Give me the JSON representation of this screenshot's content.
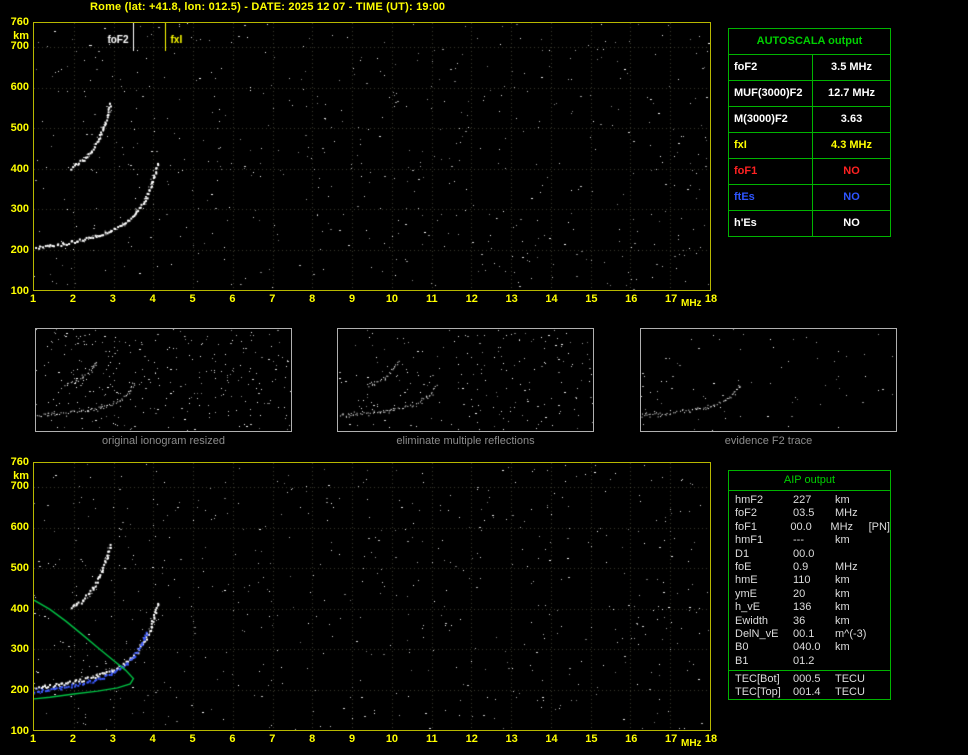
{
  "header": {
    "title": "Rome (lat: +41.8, lon: 012.5) - DATE: 2025 12 07 - TIME (UT): 19:00"
  },
  "autoscala": {
    "title": "AUTOSCALA output",
    "border_color": "#00b400",
    "rows": [
      {
        "param": "foF2",
        "value": "3.5 MHz",
        "color": "#ffffff"
      },
      {
        "param": "MUF(3000)F2",
        "value": "12.7 MHz",
        "color": "#ffffff"
      },
      {
        "param": "M(3000)F2",
        "value": "3.63",
        "color": "#ffffff"
      },
      {
        "param": "fxI",
        "value": "4.3 MHz",
        "color": "#ffff00"
      },
      {
        "param": "foF1",
        "value": "NO",
        "color": "#ff2222"
      },
      {
        "param": "ftEs",
        "value": "NO",
        "color": "#2e55ff"
      },
      {
        "param": "h'Es",
        "value": "NO",
        "color": "#ffffff"
      }
    ]
  },
  "thumbnails": {
    "panels": [
      {
        "caption": "original ionogram resized",
        "noise_density": 0.012,
        "seed": 3,
        "xlim": [
          1,
          9
        ],
        "series_names": [
          "F2-trace",
          "multiple-reflection"
        ]
      },
      {
        "caption": "eliminate multiple reflections",
        "noise_density": 0.008,
        "seed": 4,
        "xlim": [
          1,
          9
        ],
        "series_names": [
          "F2-trace",
          "multiple-reflection"
        ]
      },
      {
        "caption": "evidence F2 trace",
        "noise_density": 0.003,
        "seed": 5,
        "xlim": [
          1,
          9
        ],
        "series_names": [
          "F2-trace"
        ]
      }
    ]
  },
  "aip": {
    "title": "AIP output",
    "rows": [
      {
        "label": "hmF2",
        "value": "227",
        "unit": "km"
      },
      {
        "label": "foF2",
        "value": "03.5",
        "unit": "MHz"
      },
      {
        "label": "foF1",
        "value": "00.0",
        "unit": "MHz",
        "note": "[PN]"
      },
      {
        "label": "hmF1",
        "value": "---",
        "unit": "km"
      },
      {
        "label": "D1",
        "value": "00.0",
        "unit": ""
      },
      {
        "label": "foE",
        "value": "0.9",
        "unit": "MHz"
      },
      {
        "label": "hmE",
        "value": "110",
        "unit": "km"
      },
      {
        "label": "ymE",
        "value": "20",
        "unit": "km"
      },
      {
        "label": "h_vE",
        "value": "136",
        "unit": "km"
      },
      {
        "label": "Ewidth",
        "value": "36",
        "unit": "km"
      },
      {
        "label": "DelN_vE",
        "value": "00.1",
        "unit": "m^(-3)"
      },
      {
        "label": "B0",
        "value": "040.0",
        "unit": "km"
      },
      {
        "label": "B1",
        "value": "01.2",
        "unit": ""
      },
      {
        "label": "TEC[Bot]",
        "value": "000.5",
        "unit": "TECU",
        "divider_before": true
      },
      {
        "label": "TEC[Top]",
        "value": "001.4",
        "unit": "TECU"
      }
    ]
  },
  "chart_data": [
    {
      "id": "top_ionogram",
      "type": "scatter",
      "title": "",
      "xlabel": "MHz",
      "ylabel": "km",
      "xlim": [
        1,
        18
      ],
      "ylim": [
        100,
        760
      ],
      "x_ticks": [
        1,
        2,
        3,
        4,
        5,
        6,
        7,
        8,
        9,
        10,
        11,
        12,
        13,
        14,
        15,
        16,
        17,
        18
      ],
      "y_ticks": [
        100,
        200,
        300,
        400,
        500,
        600,
        700,
        760
      ],
      "grid": true,
      "noise_density": 0.0032,
      "seed": 7,
      "markers": [
        {
          "label": "foF2",
          "x": 3.5,
          "color": "#ffffff",
          "label_side": "left"
        },
        {
          "label": "fxI",
          "x": 4.3,
          "color": "#ffff00",
          "label_side": "right"
        }
      ],
      "series": [
        {
          "name": "F2-trace",
          "color": "#ffffff",
          "style": "dots",
          "points": [
            [
              1.05,
              205
            ],
            [
              1.4,
              210
            ],
            [
              1.8,
              217
            ],
            [
              2.2,
              225
            ],
            [
              2.6,
              236
            ],
            [
              3.0,
              251
            ],
            [
              3.3,
              268
            ],
            [
              3.55,
              291
            ],
            [
              3.75,
              319
            ],
            [
              3.9,
              350
            ],
            [
              4.0,
              382
            ],
            [
              4.12,
              418
            ]
          ]
        },
        {
          "name": "multiple-reflection",
          "color": "#ffffff",
          "style": "dots",
          "points": [
            [
              1.9,
              402
            ],
            [
              2.2,
              421
            ],
            [
              2.45,
              447
            ],
            [
              2.65,
              482
            ],
            [
              2.8,
              523
            ],
            [
              2.92,
              565
            ]
          ]
        }
      ]
    },
    {
      "id": "bottom_ionogram",
      "type": "scatter",
      "title": "",
      "xlabel": "MHz",
      "ylabel": "km",
      "xlim": [
        1,
        18
      ],
      "ylim": [
        100,
        760
      ],
      "x_ticks": [
        1,
        2,
        3,
        4,
        5,
        6,
        7,
        8,
        9,
        10,
        11,
        12,
        13,
        14,
        15,
        16,
        17,
        18
      ],
      "y_ticks": [
        100,
        200,
        300,
        400,
        500,
        600,
        700,
        760
      ],
      "grid": true,
      "noise_density": 0.0032,
      "seed": 13,
      "markers": [],
      "series": [
        {
          "name": "F2-trace",
          "color": "#ffffff",
          "style": "dots",
          "points": [
            [
              1.05,
              205
            ],
            [
              1.4,
              210
            ],
            [
              1.8,
              217
            ],
            [
              2.2,
              225
            ],
            [
              2.6,
              236
            ],
            [
              3.0,
              251
            ],
            [
              3.3,
              268
            ],
            [
              3.55,
              291
            ],
            [
              3.75,
              319
            ],
            [
              3.9,
              350
            ],
            [
              4.0,
              382
            ],
            [
              4.12,
              418
            ]
          ]
        },
        {
          "name": "multiple-reflection",
          "color": "#ffffff",
          "style": "dots",
          "points": [
            [
              1.9,
              402
            ],
            [
              2.2,
              421
            ],
            [
              2.45,
              447
            ],
            [
              2.65,
              482
            ],
            [
              2.8,
              523
            ],
            [
              2.92,
              565
            ]
          ]
        },
        {
          "name": "restored-trace",
          "color": "#3d5bff",
          "style": "dots",
          "points": [
            [
              1.0,
              196
            ],
            [
              1.5,
              203
            ],
            [
              2.0,
              212
            ],
            [
              2.5,
              223
            ],
            [
              2.9,
              239
            ],
            [
              3.2,
              257
            ],
            [
              3.5,
              283
            ],
            [
              3.7,
              313
            ],
            [
              3.85,
              348
            ]
          ]
        },
        {
          "name": "electron-density-profile",
          "color": "#00c244",
          "style": "line",
          "points": [
            [
              1.0,
              421
            ],
            [
              1.4,
              398
            ],
            [
              1.8,
              369
            ],
            [
              2.2,
              337
            ],
            [
              2.6,
              304
            ],
            [
              3.0,
              272
            ],
            [
              3.3,
              248
            ],
            [
              3.5,
              227
            ],
            [
              3.42,
              214
            ],
            [
              3.1,
              204
            ],
            [
              2.6,
              196
            ],
            [
              2.0,
              189
            ],
            [
              1.4,
              181
            ],
            [
              1.0,
              177
            ]
          ]
        }
      ]
    }
  ]
}
